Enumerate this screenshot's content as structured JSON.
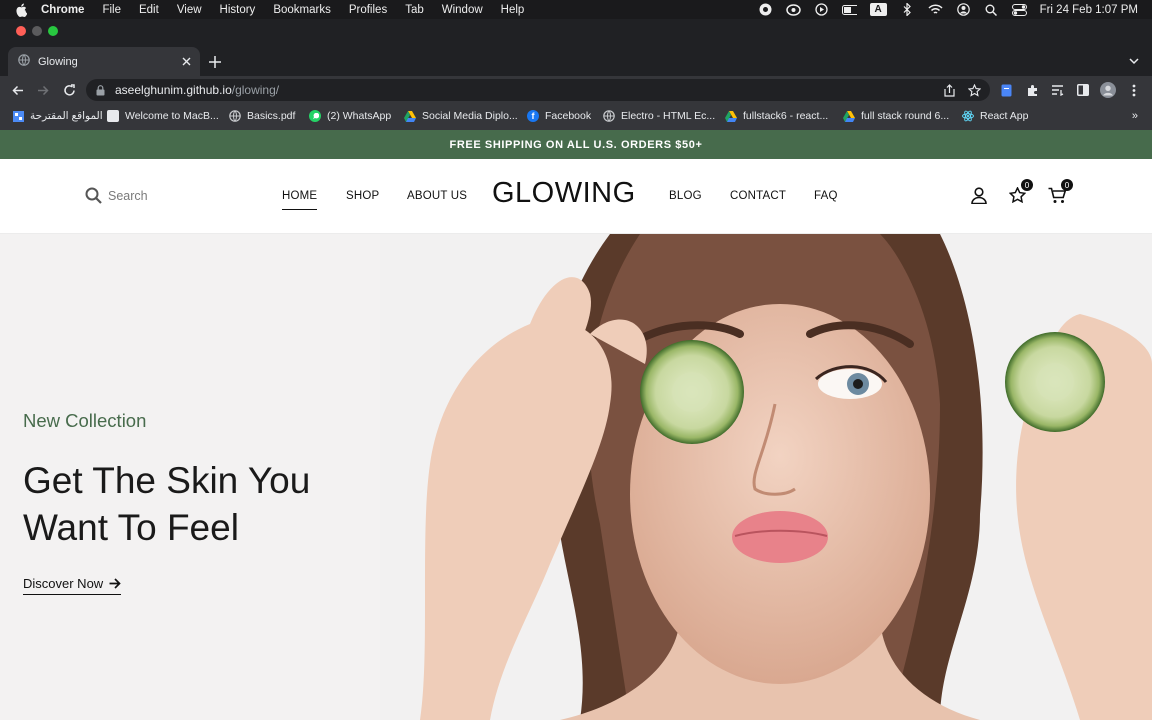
{
  "menubar": {
    "app": "Chrome",
    "items": [
      "File",
      "Edit",
      "View",
      "History",
      "Bookmarks",
      "Profiles",
      "Tab",
      "Window",
      "Help"
    ],
    "input_source": "A",
    "clock": "Fri 24 Feb  1:07 PM"
  },
  "browser": {
    "tab_title": "Glowing",
    "url_host": "aseelghunim.github.io",
    "url_path": "/glowing/",
    "bookmarks": [
      {
        "label": "المواقع المقترحة",
        "icon": "suggested-sites-icon"
      },
      {
        "label": "Welcome to MacB...",
        "icon": "page-icon"
      },
      {
        "label": "Basics.pdf",
        "icon": "globe-icon"
      },
      {
        "label": "(2) WhatsApp",
        "icon": "whatsapp-icon"
      },
      {
        "label": "Social Media Diplo...",
        "icon": "drive-icon"
      },
      {
        "label": "Facebook",
        "icon": "facebook-icon"
      },
      {
        "label": "Electro - HTML Ec...",
        "icon": "globe-icon"
      },
      {
        "label": "fullstack6 - react...",
        "icon": "drive-icon"
      },
      {
        "label": "full stack round 6...",
        "icon": "drive-icon"
      },
      {
        "label": "React App",
        "icon": "react-icon"
      }
    ],
    "bookmarks_more": "»"
  },
  "site": {
    "promo": "FREE SHIPPING ON ALL U.S. ORDERS $50+",
    "search_placeholder": "Search",
    "nav": {
      "home": "HOME",
      "shop": "SHOP",
      "about": "ABOUT US",
      "blog": "BLOG",
      "contact": "CONTACT",
      "faq": "FAQ"
    },
    "logo": "GLOWING",
    "wishlist_count": "0",
    "cart_count": "0",
    "hero": {
      "eyebrow": "New Collection",
      "headline": "Get The Skin You Want To Feel",
      "cta": "Discover Now"
    }
  },
  "colors": {
    "brand_green": "#476b4c",
    "menubar_bg": "#1a1a1c",
    "chrome_dark": "#202124",
    "chrome_toolbar": "#35363a",
    "hero_bg": "#f3f2f2"
  }
}
